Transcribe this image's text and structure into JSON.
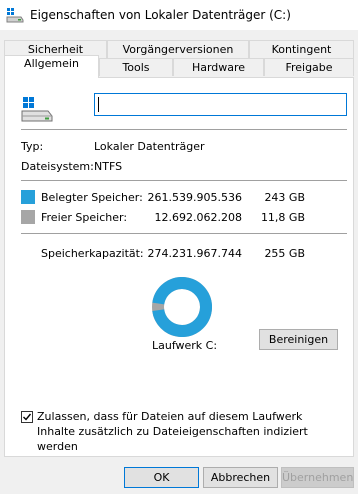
{
  "window": {
    "title": "Eigenschaften von Lokaler Datenträger (C:)"
  },
  "tabs": {
    "row_back": [
      "Sicherheit",
      "Vorgängerversionen",
      "Kontingent"
    ],
    "row_front": [
      "Allgemein",
      "Tools",
      "Hardware",
      "Freigabe"
    ],
    "active": "Allgemein"
  },
  "general": {
    "name_value": "",
    "type_label": "Typ:",
    "type_value": "Lokaler Datenträger",
    "fs_label": "Dateisystem:",
    "fs_value": "NTFS",
    "used_label": "Belegter Speicher:",
    "used_bytes": "261.539.905.536",
    "used_size": "243 GB",
    "free_label": "Freier Speicher:",
    "free_bytes": "12.692.062.208",
    "free_size": "11,8 GB",
    "capacity_label": "Speicherkapazität:",
    "capacity_bytes": "274.231.967.744",
    "capacity_size": "255 GB",
    "drive_label": "Laufwerk C:",
    "cleanup_button": "Bereinigen",
    "used_fraction": 0.9537,
    "index_checkbox_label": "Zulassen, dass für Dateien auf diesem Laufwerk Inhalte zusätzlich zu Dateieigenschaften indiziert werden",
    "index_checked": true
  },
  "buttons": {
    "ok": "OK",
    "cancel": "Abbrechen",
    "apply": "Übernehmen"
  },
  "colors": {
    "used": "#26a0da",
    "free": "#a6a6a6",
    "accent": "#0078d7"
  }
}
